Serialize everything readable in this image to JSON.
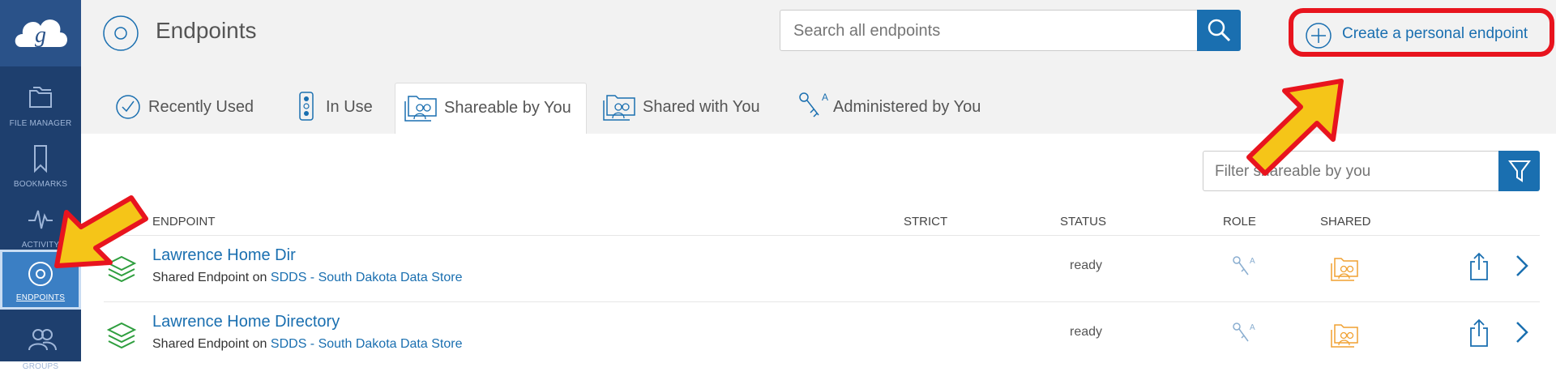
{
  "sidebar": {
    "logo": "globus-logo",
    "items": [
      {
        "label": "FILE MANAGER",
        "icon": "folder-icon"
      },
      {
        "label": "BOOKMARKS",
        "icon": "bookmark-icon"
      },
      {
        "label": "ACTIVITY",
        "icon": "activity-icon"
      },
      {
        "label": "ENDPOINTS",
        "icon": "endpoint-icon",
        "active": true
      },
      {
        "label": "GROUPS",
        "icon": "groups-icon"
      }
    ]
  },
  "header": {
    "title": "Endpoints",
    "search_placeholder": "Search all endpoints",
    "create_label": "Create a personal endpoint"
  },
  "tabs": [
    {
      "label": "Recently Used",
      "icon": "clock-icon"
    },
    {
      "label": "In Use",
      "icon": "traffic-light-icon"
    },
    {
      "label": "Shareable by You",
      "icon": "shareable-folder-icon",
      "active": true
    },
    {
      "label": "Shared with You",
      "icon": "shared-folder-icon"
    },
    {
      "label": "Administered by You",
      "icon": "keys-icon"
    }
  ],
  "filter": {
    "placeholder": "Filter shareable by you"
  },
  "table": {
    "columns": [
      "ENDPOINT",
      "STRICT",
      "STATUS",
      "ROLE",
      "SHARED"
    ],
    "rows": [
      {
        "name": "Lawrence Home Dir",
        "type": "Shared Endpoint on",
        "host": "SDDS - South Dakota Data Store",
        "status": "ready"
      },
      {
        "name": "Lawrence Home Directory",
        "type": "Shared Endpoint on",
        "host": "SDDS - South Dakota Data Store",
        "status": "ready"
      }
    ]
  },
  "colors": {
    "accent": "#1a6fb0",
    "sidebar": "#1e3f6e",
    "highlight": "#e8141e",
    "arrow": "#f5c518",
    "shared": "#f0a030",
    "endpoint_green": "#2e9e3e"
  }
}
